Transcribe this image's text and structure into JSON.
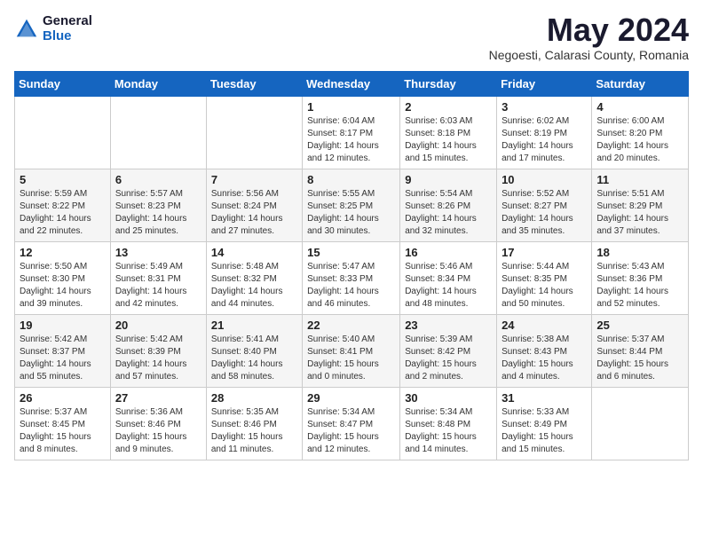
{
  "header": {
    "logo_general": "General",
    "logo_blue": "Blue",
    "month_title": "May 2024",
    "location": "Negoesti, Calarasi County, Romania"
  },
  "days_of_week": [
    "Sunday",
    "Monday",
    "Tuesday",
    "Wednesday",
    "Thursday",
    "Friday",
    "Saturday"
  ],
  "weeks": [
    [
      {
        "num": "",
        "info": ""
      },
      {
        "num": "",
        "info": ""
      },
      {
        "num": "",
        "info": ""
      },
      {
        "num": "1",
        "info": "Sunrise: 6:04 AM\nSunset: 8:17 PM\nDaylight: 14 hours\nand 12 minutes."
      },
      {
        "num": "2",
        "info": "Sunrise: 6:03 AM\nSunset: 8:18 PM\nDaylight: 14 hours\nand 15 minutes."
      },
      {
        "num": "3",
        "info": "Sunrise: 6:02 AM\nSunset: 8:19 PM\nDaylight: 14 hours\nand 17 minutes."
      },
      {
        "num": "4",
        "info": "Sunrise: 6:00 AM\nSunset: 8:20 PM\nDaylight: 14 hours\nand 20 minutes."
      }
    ],
    [
      {
        "num": "5",
        "info": "Sunrise: 5:59 AM\nSunset: 8:22 PM\nDaylight: 14 hours\nand 22 minutes."
      },
      {
        "num": "6",
        "info": "Sunrise: 5:57 AM\nSunset: 8:23 PM\nDaylight: 14 hours\nand 25 minutes."
      },
      {
        "num": "7",
        "info": "Sunrise: 5:56 AM\nSunset: 8:24 PM\nDaylight: 14 hours\nand 27 minutes."
      },
      {
        "num": "8",
        "info": "Sunrise: 5:55 AM\nSunset: 8:25 PM\nDaylight: 14 hours\nand 30 minutes."
      },
      {
        "num": "9",
        "info": "Sunrise: 5:54 AM\nSunset: 8:26 PM\nDaylight: 14 hours\nand 32 minutes."
      },
      {
        "num": "10",
        "info": "Sunrise: 5:52 AM\nSunset: 8:27 PM\nDaylight: 14 hours\nand 35 minutes."
      },
      {
        "num": "11",
        "info": "Sunrise: 5:51 AM\nSunset: 8:29 PM\nDaylight: 14 hours\nand 37 minutes."
      }
    ],
    [
      {
        "num": "12",
        "info": "Sunrise: 5:50 AM\nSunset: 8:30 PM\nDaylight: 14 hours\nand 39 minutes."
      },
      {
        "num": "13",
        "info": "Sunrise: 5:49 AM\nSunset: 8:31 PM\nDaylight: 14 hours\nand 42 minutes."
      },
      {
        "num": "14",
        "info": "Sunrise: 5:48 AM\nSunset: 8:32 PM\nDaylight: 14 hours\nand 44 minutes."
      },
      {
        "num": "15",
        "info": "Sunrise: 5:47 AM\nSunset: 8:33 PM\nDaylight: 14 hours\nand 46 minutes."
      },
      {
        "num": "16",
        "info": "Sunrise: 5:46 AM\nSunset: 8:34 PM\nDaylight: 14 hours\nand 48 minutes."
      },
      {
        "num": "17",
        "info": "Sunrise: 5:44 AM\nSunset: 8:35 PM\nDaylight: 14 hours\nand 50 minutes."
      },
      {
        "num": "18",
        "info": "Sunrise: 5:43 AM\nSunset: 8:36 PM\nDaylight: 14 hours\nand 52 minutes."
      }
    ],
    [
      {
        "num": "19",
        "info": "Sunrise: 5:42 AM\nSunset: 8:37 PM\nDaylight: 14 hours\nand 55 minutes."
      },
      {
        "num": "20",
        "info": "Sunrise: 5:42 AM\nSunset: 8:39 PM\nDaylight: 14 hours\nand 57 minutes."
      },
      {
        "num": "21",
        "info": "Sunrise: 5:41 AM\nSunset: 8:40 PM\nDaylight: 14 hours\nand 58 minutes."
      },
      {
        "num": "22",
        "info": "Sunrise: 5:40 AM\nSunset: 8:41 PM\nDaylight: 15 hours\nand 0 minutes."
      },
      {
        "num": "23",
        "info": "Sunrise: 5:39 AM\nSunset: 8:42 PM\nDaylight: 15 hours\nand 2 minutes."
      },
      {
        "num": "24",
        "info": "Sunrise: 5:38 AM\nSunset: 8:43 PM\nDaylight: 15 hours\nand 4 minutes."
      },
      {
        "num": "25",
        "info": "Sunrise: 5:37 AM\nSunset: 8:44 PM\nDaylight: 15 hours\nand 6 minutes."
      }
    ],
    [
      {
        "num": "26",
        "info": "Sunrise: 5:37 AM\nSunset: 8:45 PM\nDaylight: 15 hours\nand 8 minutes."
      },
      {
        "num": "27",
        "info": "Sunrise: 5:36 AM\nSunset: 8:46 PM\nDaylight: 15 hours\nand 9 minutes."
      },
      {
        "num": "28",
        "info": "Sunrise: 5:35 AM\nSunset: 8:46 PM\nDaylight: 15 hours\nand 11 minutes."
      },
      {
        "num": "29",
        "info": "Sunrise: 5:34 AM\nSunset: 8:47 PM\nDaylight: 15 hours\nand 12 minutes."
      },
      {
        "num": "30",
        "info": "Sunrise: 5:34 AM\nSunset: 8:48 PM\nDaylight: 15 hours\nand 14 minutes."
      },
      {
        "num": "31",
        "info": "Sunrise: 5:33 AM\nSunset: 8:49 PM\nDaylight: 15 hours\nand 15 minutes."
      },
      {
        "num": "",
        "info": ""
      }
    ]
  ]
}
